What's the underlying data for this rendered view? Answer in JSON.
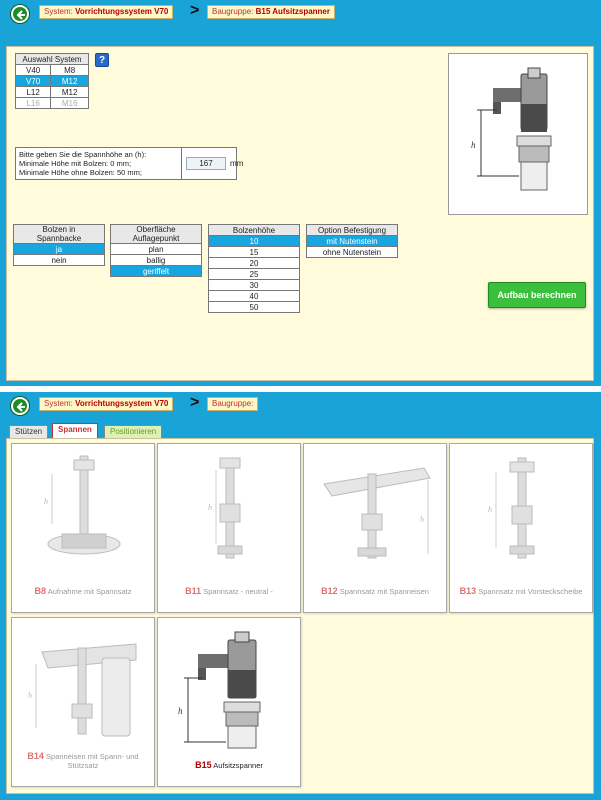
{
  "colors": {
    "accent": "#18a6e0",
    "panel": "#fffbdb",
    "button": "#3cbf3c",
    "brand_red": "#b30000"
  },
  "screen1": {
    "breadcrumb": {
      "system_label": "System:",
      "system_value": "Vorrichtungssystem V70",
      "group_label": "Baugruppe:",
      "group_value": "B15 Aufsitzspanner"
    },
    "system_table": {
      "header": "Auswahl System",
      "rows": [
        [
          "V40",
          "M8"
        ],
        [
          "V70",
          "M12"
        ],
        [
          "L12",
          "M12"
        ],
        [
          "L16",
          "M16"
        ]
      ]
    },
    "help_icon": "?",
    "height_prompt": {
      "line1": "Bitte geben Sie die Spannhöhe an (h):",
      "line2": "Minimale Höhe mit Bolzen: 0 mm;",
      "line3": "Minimale Höhe ohne Bolzen: 50 mm;",
      "value": "167",
      "unit": "mm"
    },
    "options": {
      "bolzen": {
        "header_l1": "Bolzen in",
        "header_l2": "Spannbacke",
        "items": [
          "ja",
          "nein"
        ]
      },
      "oberflaeche": {
        "header_l1": "Oberfläche",
        "header_l2": "Auflagepunkt",
        "items": [
          "plan",
          "ballig",
          "geriffelt"
        ]
      },
      "bolzenhoehe": {
        "header": "Bolzenhöhe",
        "items": [
          "10",
          "15",
          "20",
          "25",
          "30",
          "40",
          "50"
        ]
      },
      "befestigung": {
        "header": "Option Befestigung",
        "items": [
          "mit Nutenstein",
          "ohne Nutenstein"
        ]
      }
    },
    "calc_button": "Aufbau berechnen"
  },
  "screen2": {
    "breadcrumb": {
      "system_label": "System:",
      "system_value": "Vorrichtungssystem V70",
      "group_label": "Baugruppe:",
      "group_value": ""
    },
    "tabs": [
      "Stützen",
      "Spannen",
      "Positionieren"
    ],
    "cards": [
      {
        "code": "B8",
        "label": "Aufnahme mit Spannsatz"
      },
      {
        "code": "B11",
        "label": "Spannsatz - neutral -"
      },
      {
        "code": "B12",
        "label": "Spannsatz mit Spanneisen"
      },
      {
        "code": "B13",
        "label": "Spannsatz mit Vorsteckscheibe"
      },
      {
        "code": "B14",
        "label": "Spanneisen mit Spann- und Stützsatz"
      },
      {
        "code": "B15",
        "label": "Aufsitzspanner"
      }
    ]
  }
}
